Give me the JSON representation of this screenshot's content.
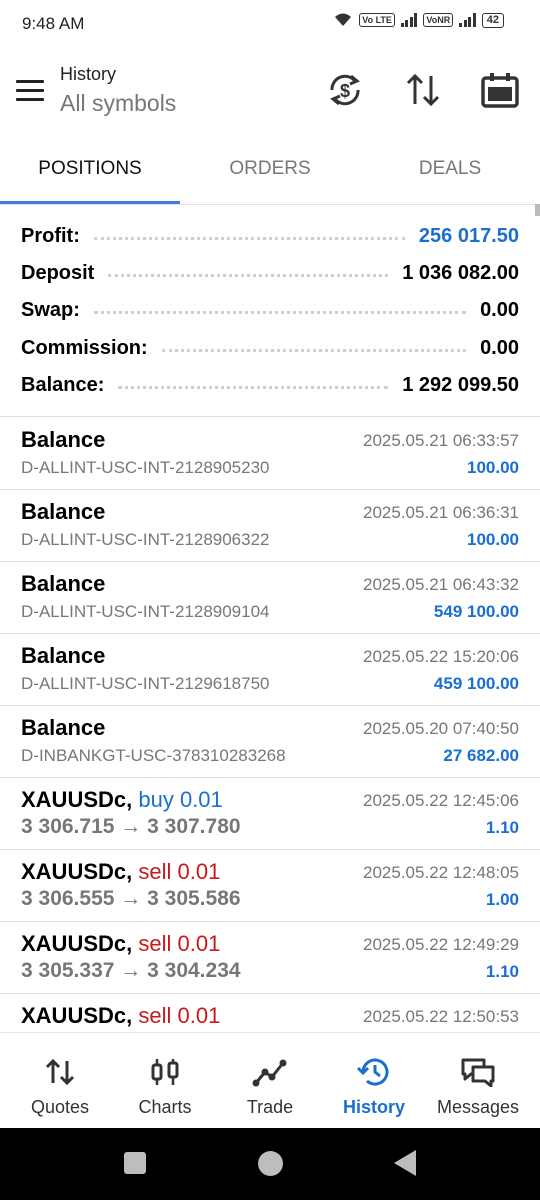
{
  "status_bar": {
    "time": "9:48 AM",
    "volte_badge": "Vo LTE",
    "vonr_badge": "VoNR",
    "battery": "42"
  },
  "appbar": {
    "subtitle": "History",
    "title": "All symbols",
    "icons": [
      "menu-icon",
      "currency-sync-icon",
      "sort-icon",
      "calendar-icon"
    ]
  },
  "tabs": [
    {
      "label": "POSITIONS",
      "active": true
    },
    {
      "label": "ORDERS",
      "active": false
    },
    {
      "label": "DEALS",
      "active": false
    }
  ],
  "summary": [
    {
      "label": "Profit:",
      "value": "256 017.50",
      "accent": true
    },
    {
      "label": "Deposit",
      "value": "1 036 082.00",
      "accent": false
    },
    {
      "label": "Swap:",
      "value": "0.00",
      "accent": false
    },
    {
      "label": "Commission:",
      "value": "0.00",
      "accent": false
    },
    {
      "label": "Balance:",
      "value": "1 292 099.50",
      "accent": false
    }
  ],
  "deals": [
    {
      "title": "Balance",
      "sub": "D-ALLINT-USC-INT-2128905230",
      "time": "2025.05.21 06:33:57",
      "amount": "100.00"
    },
    {
      "title": "Balance",
      "sub": "D-ALLINT-USC-INT-2128906322",
      "time": "2025.05.21 06:36:31",
      "amount": "100.00"
    },
    {
      "title": "Balance",
      "sub": "D-ALLINT-USC-INT-2128909104",
      "time": "2025.05.21 06:43:32",
      "amount": "549 100.00"
    },
    {
      "title": "Balance",
      "sub": "D-ALLINT-USC-INT-2129618750",
      "time": "2025.05.22 15:20:06",
      "amount": "459 100.00"
    },
    {
      "title": "Balance",
      "sub": "D-INBANKGT-USC-378310283268",
      "time": "2025.05.20 07:40:50",
      "amount": "27 682.00"
    }
  ],
  "trades": [
    {
      "symbol": "XAUUSDc,",
      "side": "buy 0.01",
      "side_color": "#1a6fd1",
      "open": "3 306.715",
      "arrow": "→",
      "close": "3 307.780",
      "time": "2025.05.22 12:45:06",
      "profit": "1.10"
    },
    {
      "symbol": "XAUUSDc,",
      "side": "sell 0.01",
      "side_color": "#c8191a",
      "open": "3 306.555",
      "arrow": "→",
      "close": "3 305.586",
      "time": "2025.05.22 12:48:05",
      "profit": "1.00"
    },
    {
      "symbol": "XAUUSDc,",
      "side": "sell 0.01",
      "side_color": "#c8191a",
      "open": "3 305.337",
      "arrow": "→",
      "close": "3 304.234",
      "time": "2025.05.22 12:49:29",
      "profit": "1.10"
    },
    {
      "symbol": "XAUUSDc,",
      "side": "sell 0.01",
      "side_color": "#c8191a",
      "open": "",
      "arrow": "",
      "close": "",
      "time": "2025.05.22 12:50:53",
      "profit": ""
    }
  ],
  "bottom_nav": [
    {
      "label": "Quotes",
      "icon": "quotes-icon",
      "active": false
    },
    {
      "label": "Charts",
      "icon": "charts-icon",
      "active": false
    },
    {
      "label": "Trade",
      "icon": "trade-icon",
      "active": false
    },
    {
      "label": "History",
      "icon": "history-icon",
      "active": true
    },
    {
      "label": "Messages",
      "icon": "messages-icon",
      "active": false
    }
  ],
  "colors": {
    "accent_blue": "#1a6fd1",
    "sell_red": "#c8191a",
    "tab_indicator": "#3b7dd8"
  }
}
